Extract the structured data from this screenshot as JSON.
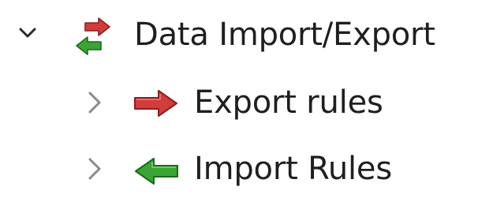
{
  "tree": {
    "root": {
      "label": "Data Import/Export",
      "expanded": true,
      "chevron_icon": "chevron-down-icon",
      "icon": "import-export-arrows-icon"
    },
    "children": [
      {
        "label": "Export rules",
        "expanded": false,
        "chevron_icon": "chevron-right-icon",
        "icon": "red-arrow-right-icon"
      },
      {
        "label": "Import Rules",
        "expanded": false,
        "chevron_icon": "chevron-right-icon",
        "icon": "green-arrow-left-icon"
      }
    ]
  },
  "colors": {
    "export_arrow": "#d23c3c",
    "import_arrow": "#2f9a2a",
    "chevron_expanded": "#2a2a2a",
    "chevron_collapsed": "#8a8a8a"
  }
}
